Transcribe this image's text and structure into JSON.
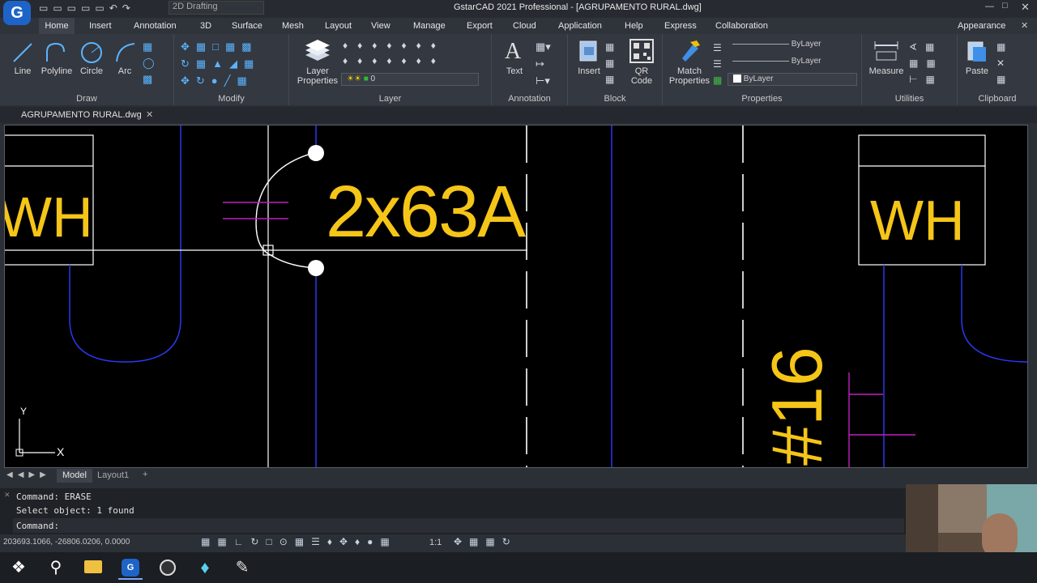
{
  "app": {
    "title": "GstarCAD 2021 Professional - [AGRUPAMENTO RURAL.dwg]",
    "workspace": "2D Drafting"
  },
  "menu_tabs": [
    "Home",
    "Insert",
    "Annotation",
    "3D",
    "Surface",
    "Mesh",
    "Layout",
    "View",
    "Manage",
    "Export",
    "Cloud",
    "Application",
    "Help",
    "Express",
    "Collaboration"
  ],
  "appearance": "Appearance",
  "ribbon": {
    "draw": {
      "line": "Line",
      "polyline": "Polyline",
      "circle": "Circle",
      "arc": "Arc",
      "label": "Draw"
    },
    "modify": {
      "label": "Modify"
    },
    "layer": {
      "properties": "Layer\nProperties",
      "current": "0",
      "label": "Layer"
    },
    "annotation": {
      "text": "Text",
      "label": "Annotation"
    },
    "block": {
      "insert": "Insert",
      "qr": "QR\nCode",
      "label": "Block"
    },
    "properties": {
      "match": "Match\nProperties",
      "bylayer1": "ByLayer",
      "bylayer2": "ByLayer",
      "bylayer3": "ByLayer",
      "label": "Properties"
    },
    "utilities": {
      "measure": "Measure",
      "label": "Utilities"
    },
    "clipboard": {
      "paste": "Paste",
      "label": "Clipboard"
    }
  },
  "doc_tab": "AGRUPAMENTO RURAL.dwg",
  "drawing": {
    "label_left": "WH",
    "label_right": "WH",
    "breaker": "2x63A",
    "circuit": "#16",
    "ucs_y": "Y",
    "ucs_x": "X"
  },
  "layout_tabs": {
    "model": "Model",
    "layout1": "Layout1",
    "add": "+"
  },
  "command": {
    "line1": "Command:  ERASE",
    "line2": "Select object:  1 found",
    "prompt": "Command:"
  },
  "status": {
    "coords": "203693.1066, -26806.0206, 0.0000",
    "scale": "1:1"
  },
  "colors": {
    "accent": "#f5c518",
    "blue": "#2b3cff",
    "magenta": "#c020c0",
    "bg": "#000000"
  }
}
